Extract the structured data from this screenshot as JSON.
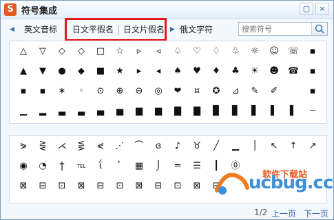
{
  "window": {
    "title": "符号集成",
    "logo": "S",
    "close": "×",
    "pin": "▢"
  },
  "tabs": {
    "prev_arrow": "◀",
    "next_arrow": "▶",
    "items": [
      {
        "label": "英文音标"
      },
      {
        "label": "日文平假名"
      },
      {
        "label": "日文片假名"
      },
      {
        "label": "俄文字符"
      }
    ]
  },
  "search": {
    "placeholder": "搜索符号"
  },
  "palette1": {
    "rows": [
      [
        "△",
        "▽",
        "◇",
        "◇",
        "□",
        "☆",
        "▹",
        "◃",
        "♤",
        "♡",
        "♢",
        "♧",
        "☼",
        "☺",
        "☏",
        "▪"
      ],
      [
        "▲",
        "▼",
        "●",
        "◆",
        "■",
        "★",
        "▸",
        "◂",
        "♠",
        "♥",
        "♦",
        "♣",
        "☀",
        "☻",
        "☎",
        "▪"
      ],
      [
        "▪",
        "▪",
        "∗",
        "◦",
        "⊙",
        "⊕",
        "⊖",
        "◎",
        "❤",
        "¤",
        "✪",
        "⊿",
        "✎",
        "✐",
        "",
        "▪"
      ],
      [
        "▁",
        "▂",
        "▃",
        "▃",
        "▄",
        "▅",
        "▆",
        "▆",
        "▇",
        "▇",
        "▉",
        "▊",
        "▋",
        "▌",
        "▌",
        "┈"
      ]
    ]
  },
  "palette2": {
    "rows": [
      [
        "⋟",
        "⋛",
        "⋌",
        "⋚",
        "⋞",
        "⋰",
        "⌒",
        "ɞ",
        "♪",
        "♉",
        "╱",
        "▁",
        "│",
        "↖",
        "↑",
        "↗"
      ],
      [
        "◉",
        "◔",
        "ϯ",
        "TEL",
        "ΐ",
        "ﾟ",
        "▦",
        "⌡",
        "═",
        "☰",
        "┃",
        "⓪",
        "",
        "",
        "",
        ""
      ],
      [
        "⊠",
        "⊟",
        "⊡",
        "⊠",
        "⊟",
        "⊡",
        "⊠",
        "⊟",
        "⊡",
        "⊠",
        "⊟",
        "",
        "",
        "",
        "",
        ""
      ]
    ]
  },
  "footer": {
    "page": "1/2",
    "prev": "上一页",
    "next": "下一页"
  },
  "watermark": {
    "text": "ucbug.cc",
    "sub": "软件下载站"
  },
  "colors": {
    "highlight": "#e3161c",
    "accent": "#2b5ea8",
    "brand": "#e4571e"
  }
}
